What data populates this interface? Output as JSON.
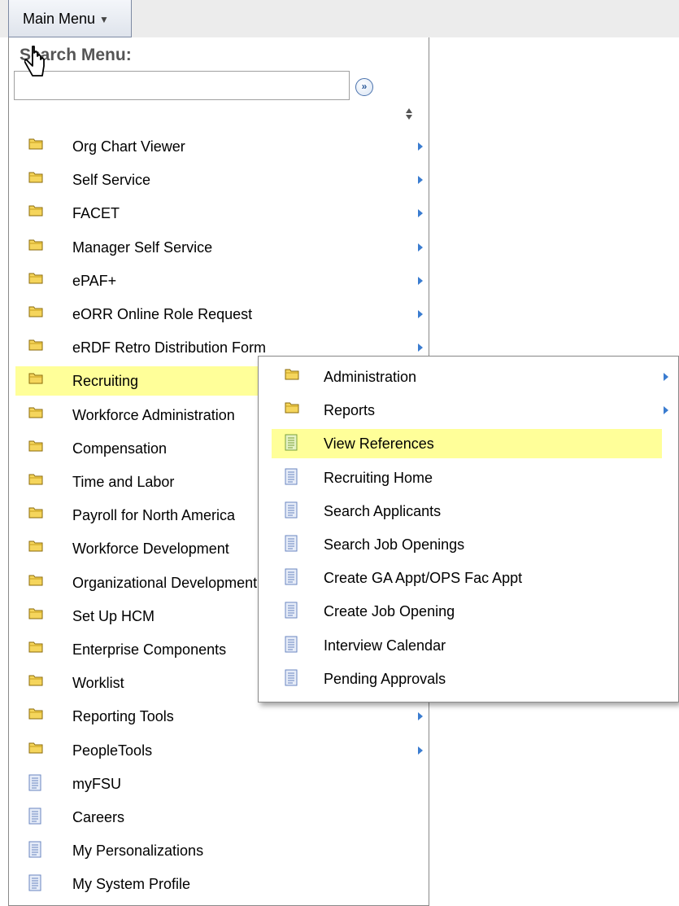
{
  "header": {
    "main_menu_label": "Main Menu",
    "caret": "▼"
  },
  "search": {
    "label": "Search Menu:",
    "value": "",
    "go_glyph": "»"
  },
  "menu": {
    "items": [
      {
        "label": "Org Chart Viewer",
        "icon": "folder-icon",
        "has_submenu": true
      },
      {
        "label": "Self Service",
        "icon": "folder-icon",
        "has_submenu": true
      },
      {
        "label": "FACET",
        "icon": "folder-icon",
        "has_submenu": true
      },
      {
        "label": "Manager Self Service",
        "icon": "folder-icon",
        "has_submenu": true
      },
      {
        "label": "ePAF+",
        "icon": "folder-icon",
        "has_submenu": true
      },
      {
        "label": "eORR Online Role Request",
        "icon": "folder-icon",
        "has_submenu": true
      },
      {
        "label": "eRDF Retro Distribution Form",
        "icon": "folder-icon",
        "has_submenu": true
      },
      {
        "label": "Recruiting",
        "icon": "folder-icon",
        "has_submenu": true,
        "highlighted": true
      },
      {
        "label": "Workforce Administration",
        "icon": "folder-icon",
        "has_submenu": true
      },
      {
        "label": "Compensation",
        "icon": "folder-icon",
        "has_submenu": true
      },
      {
        "label": "Time and Labor",
        "icon": "folder-icon",
        "has_submenu": true
      },
      {
        "label": "Payroll for North America",
        "icon": "folder-icon",
        "has_submenu": true
      },
      {
        "label": "Workforce Development",
        "icon": "folder-icon",
        "has_submenu": true
      },
      {
        "label": "Organizational Development",
        "icon": "folder-icon",
        "has_submenu": true
      },
      {
        "label": "Set Up HCM",
        "icon": "folder-icon",
        "has_submenu": true
      },
      {
        "label": "Enterprise Components",
        "icon": "folder-icon",
        "has_submenu": true
      },
      {
        "label": "Worklist",
        "icon": "folder-icon",
        "has_submenu": true
      },
      {
        "label": "Reporting Tools",
        "icon": "folder-icon",
        "has_submenu": true
      },
      {
        "label": "PeopleTools",
        "icon": "folder-icon",
        "has_submenu": true
      },
      {
        "label": "myFSU",
        "icon": "page-icon",
        "has_submenu": false
      },
      {
        "label": "Careers",
        "icon": "page-icon",
        "has_submenu": false
      },
      {
        "label": "My Personalizations",
        "icon": "page-icon",
        "has_submenu": false
      },
      {
        "label": "My System Profile",
        "icon": "page-icon",
        "has_submenu": false
      }
    ]
  },
  "submenu": {
    "parent": "Recruiting",
    "items": [
      {
        "label": "Administration",
        "icon": "folder-icon",
        "has_submenu": true
      },
      {
        "label": "Reports",
        "icon": "folder-icon",
        "has_submenu": true
      },
      {
        "label": "View References",
        "icon": "page-icon",
        "has_submenu": false,
        "highlighted": true
      },
      {
        "label": "Recruiting Home",
        "icon": "page-icon",
        "has_submenu": false
      },
      {
        "label": "Search Applicants",
        "icon": "page-icon",
        "has_submenu": false
      },
      {
        "label": "Search Job Openings",
        "icon": "page-icon",
        "has_submenu": false
      },
      {
        "label": "Create GA Appt/OPS Fac Appt",
        "icon": "page-icon",
        "has_submenu": false
      },
      {
        "label": "Create Job Opening",
        "icon": "page-icon",
        "has_submenu": false
      },
      {
        "label": "Interview Calendar",
        "icon": "page-icon",
        "has_submenu": false
      },
      {
        "label": "Pending Approvals",
        "icon": "page-icon",
        "has_submenu": false
      }
    ]
  },
  "colors": {
    "highlight": "#ffff99",
    "folder": "#f5d55c",
    "page": "#e6ecf8",
    "page_active": "#e4f2c4",
    "arrow": "#3a7cd0"
  }
}
